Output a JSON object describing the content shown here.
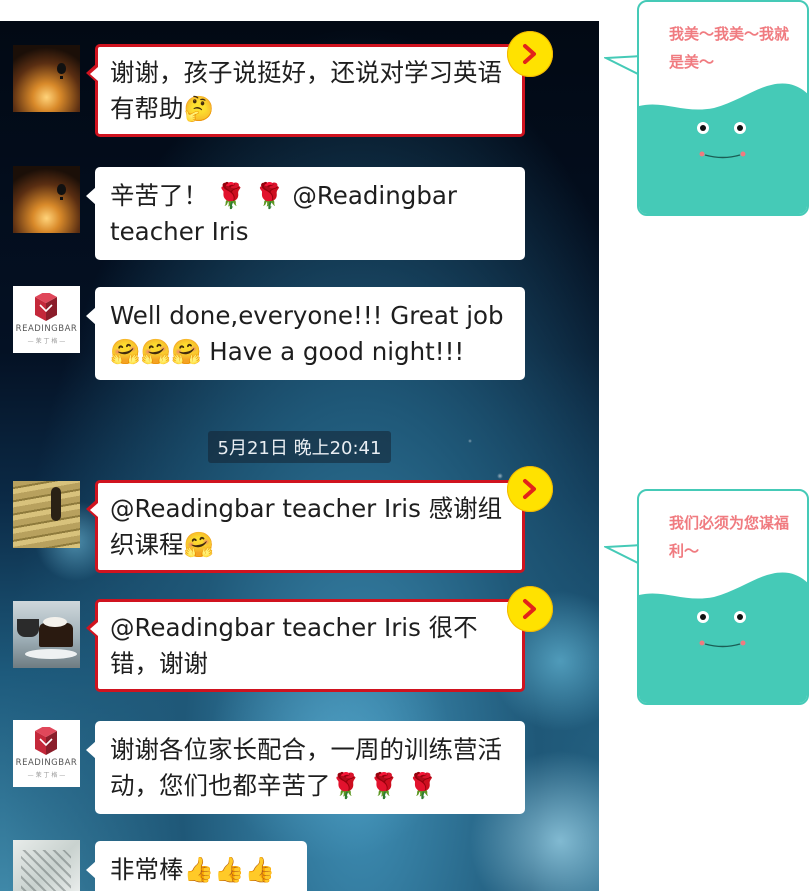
{
  "chat": {
    "messages": [
      {
        "avatar": "sunset-balloon-avatar",
        "text": "谢谢，孩子说挺好，还说对学习英语有帮助🤔",
        "highlighted": true
      },
      {
        "avatar": "sunset-balloon-avatar",
        "text": "辛苦了！ 🌹 🌹 @Readingbar teacher Iris",
        "highlighted": false
      },
      {
        "avatar": "readingbar-logo-avatar",
        "text": "Well done,everyone!!! Great job🤗🤗🤗 Have a good night!!!",
        "highlighted": false
      },
      {
        "avatar": "stairs-photo-avatar",
        "text": "@Readingbar teacher Iris 感谢组织课程🤗",
        "highlighted": true
      },
      {
        "avatar": "coffee-cake-avatar",
        "text": "@Readingbar teacher Iris 很不错，谢谢",
        "highlighted": true
      },
      {
        "avatar": "readingbar-logo-avatar",
        "text": "谢谢各位家长配合，一周的训练营活动，您们也都辛苦了🌹 🌹 🌹",
        "highlighted": false
      },
      {
        "avatar": "sketch-avatar",
        "text": "非常棒👍👍👍",
        "highlighted": false
      }
    ],
    "timestamp": "5月21日 晚上20:41",
    "logo_brand": "READINGBAR",
    "logo_sub": "— 茉 丁 格 —"
  },
  "mascots": [
    {
      "text": "我美～我美～我就是美～"
    },
    {
      "text": "我们必须为您谋福利～"
    }
  ],
  "colors": {
    "highlight_border": "#d0131f",
    "badge_yellow": "#ffe200",
    "mascot_teal": "#45cab7",
    "mascot_text": "#f07b80"
  }
}
